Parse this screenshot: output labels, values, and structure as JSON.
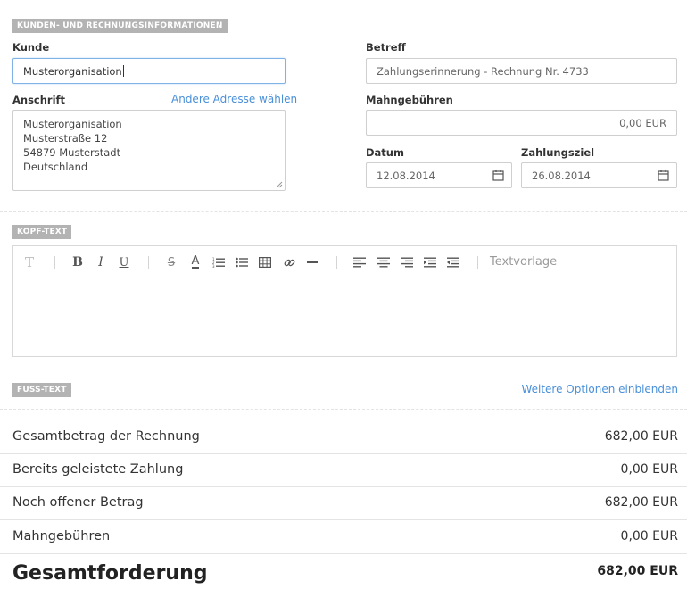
{
  "sections": {
    "customer": "KUNDEN- UND RECHNUNGSINFORMATIONEN",
    "header_text": "KOPF-TEXT",
    "footer_text": "FUSS-TEXT"
  },
  "customer": {
    "label": "Kunde",
    "value": "Musterorganisation"
  },
  "address": {
    "label": "Anschrift",
    "change_link": "Andere Adresse wählen",
    "lines": [
      "Musterorganisation",
      "Musterstraße 12",
      "54879 Musterstadt",
      "Deutschland"
    ]
  },
  "subject": {
    "label": "Betreff",
    "value": "Zahlungserinnerung - Rechnung Nr. 4733"
  },
  "fees": {
    "label": "Mahngebühren",
    "value": "0,00 EUR"
  },
  "date": {
    "label": "Datum",
    "value": "12.08.2014"
  },
  "due": {
    "label": "Zahlungsziel",
    "value": "26.08.2014"
  },
  "editor": {
    "template_label": "Textvorlage"
  },
  "footer": {
    "more_options": "Weitere Optionen einblenden"
  },
  "summary": {
    "rows": [
      {
        "label": "Gesamtbetrag der Rechnung",
        "value": "682,00 EUR"
      },
      {
        "label": "Bereits geleistete Zahlung",
        "value": "0,00 EUR"
      },
      {
        "label": "Noch offener Betrag",
        "value": "682,00 EUR"
      },
      {
        "label": "Mahngebühren",
        "value": "0,00 EUR"
      }
    ],
    "total_label": "Gesamtforderung",
    "total_value": "682,00 EUR"
  }
}
